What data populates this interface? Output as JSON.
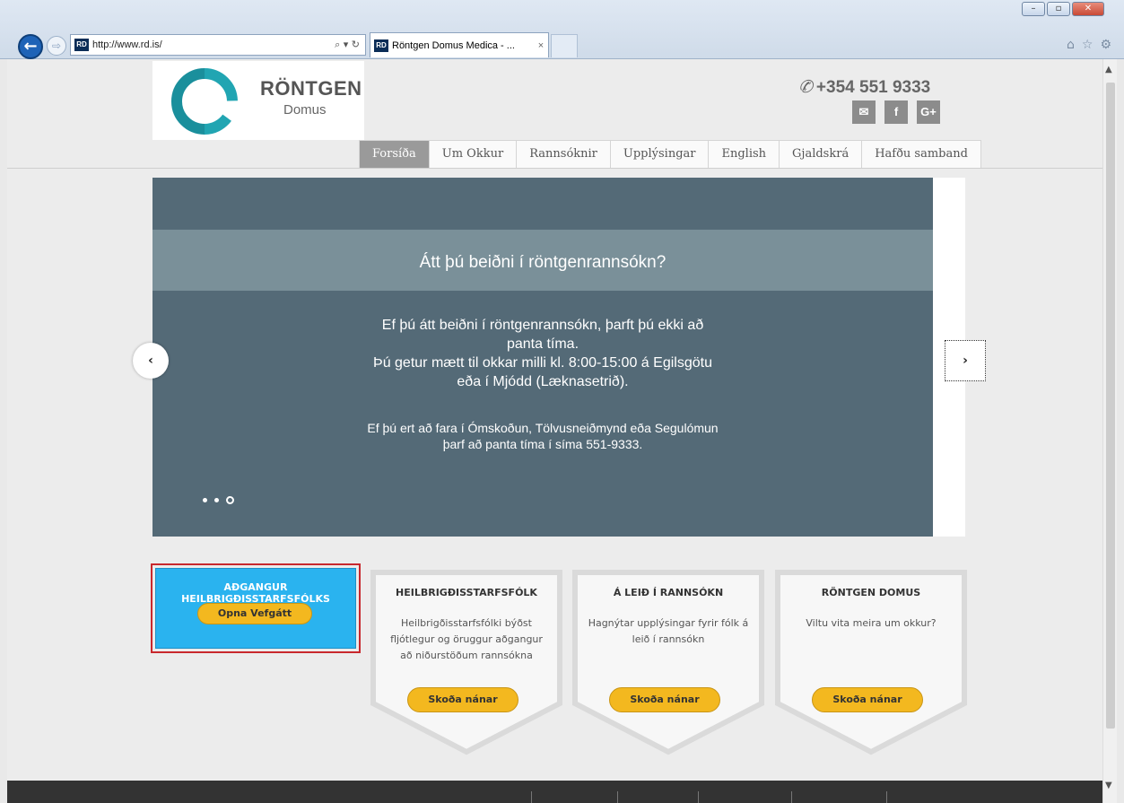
{
  "browser": {
    "url": "http://www.rd.is/",
    "favicon_text": "RD",
    "tab_title": "Röntgen Domus Medica - ...",
    "tab_close": "×",
    "back": "←",
    "forward": "⇨",
    "address_icons": "⌕ ▾ ↻",
    "toolbar_icons": [
      "⌂",
      "☆",
      "⚙"
    ],
    "window_controls": [
      "–",
      "▫",
      "✕"
    ]
  },
  "header": {
    "logo_title": "RÖNTGEN",
    "logo_subtitle": "Domus",
    "phone_icon": "✆",
    "phone": "+354 551 9333",
    "social": [
      "✉",
      "f",
      "G+"
    ]
  },
  "nav": {
    "items": [
      "Forsíða",
      "Um Okkur",
      "Rannsóknir",
      "Upplýsingar",
      "English",
      "Gjaldskrá",
      "Hafðu samband"
    ],
    "active_index": 0
  },
  "slider": {
    "heading": "Átt þú beiðni í röntgenrannsókn?",
    "body_lines": [
      "Ef þú átt beiðni í röntgenrannsókn, þarft þú ekki að",
      "panta tíma.",
      "Þú getur mætt til okkar milli kl. 8:00-15:00 á Egilsgötu",
      "eða í Mjódd (Læknasetrið)."
    ],
    "note_lines": [
      "Ef þú ert að fara í Ómskoðun, Tölvusneiðmynd eða Segulómun",
      "þarf að panta tíma í síma 551-9333."
    ],
    "prev": "‹",
    "next": "›",
    "dot_count": 3,
    "active_dot": 2
  },
  "access": {
    "title_lines": [
      "AÐGANGUR",
      "HEILBRIGÐISSTARFSFÓLKS"
    ],
    "button": "Opna Vefgátt"
  },
  "cards": [
    {
      "title": "HEILBRIGÐISSTARFSFÓLK",
      "text": "Heilbrigðisstarfsfólki býðst fljótlegur og öruggur aðgangur að niðurstöðum rannsókna",
      "button": "Skoða nánar"
    },
    {
      "title": "Á LEIÐ Í RANNSÓKN",
      "text": "Hagnýtar upplýsingar fyrir fólk á leið í rannsókn",
      "button": "Skoða nánar"
    },
    {
      "title": "RÖNTGEN DOMUS",
      "text": "Viltu vita meira um okkur?",
      "button": "Skoða nánar"
    }
  ],
  "colors": {
    "slider_bg": "#546a77",
    "slider_band": "#7a9099",
    "access_bg": "#2ab3ef",
    "button_yellow": "#f3b81f",
    "highlight_border": "#c8282d",
    "logo_teal": "#1a8f9c"
  }
}
